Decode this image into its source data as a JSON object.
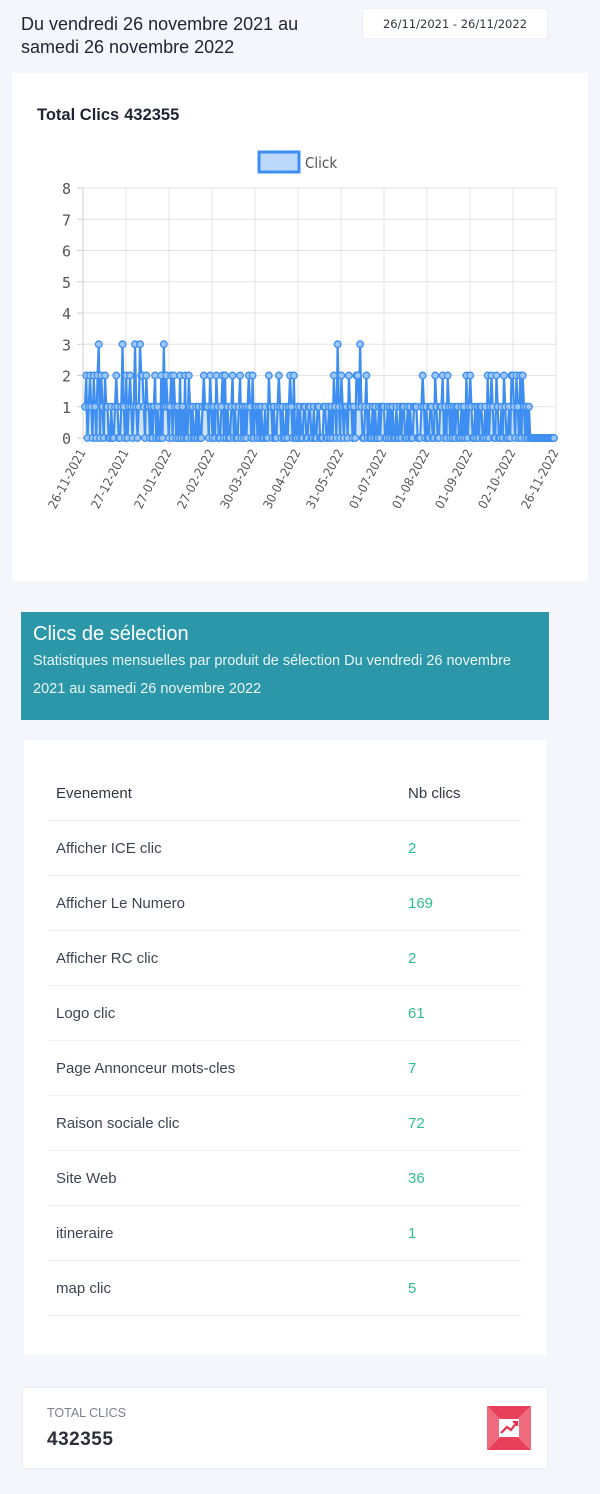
{
  "header": {
    "title": "Du vendredi 26 novembre 2021 au samedi 26 novembre 2022",
    "date_range": "26/11/2021 - 26/11/2022"
  },
  "chart_card": {
    "title_label": "Total Clics",
    "title_value": "432355"
  },
  "chart_data": {
    "type": "line",
    "legend": [
      "Click"
    ],
    "legend_position": "top",
    "series_color": "#3d8ef0",
    "ylim": [
      0,
      8
    ],
    "y_ticks": [
      "0",
      "1",
      "2",
      "3",
      "4",
      "5",
      "6",
      "7",
      "8"
    ],
    "x_ticks": [
      "26-11-2021",
      "27-12-2021",
      "27-01-2022",
      "27-02-2022",
      "30-03-2022",
      "30-04-2022",
      "31-05-2022",
      "01-07-2022",
      "01-08-2022",
      "01-09-2022",
      "02-10-2022",
      "26-11-2022"
    ],
    "series": [
      {
        "name": "Click",
        "values": [
          1,
          2,
          0,
          1,
          2,
          1,
          0,
          2,
          1,
          0,
          2,
          3,
          0,
          2,
          1,
          0,
          2,
          1,
          1,
          0,
          0,
          1,
          0,
          0,
          1,
          2,
          1,
          0,
          0,
          1,
          3,
          1,
          0,
          2,
          0,
          1,
          2,
          1,
          0,
          1,
          3,
          1,
          0,
          1,
          3,
          2,
          2,
          1,
          0,
          2,
          1,
          1,
          0,
          1,
          0,
          1,
          2,
          0,
          1,
          0,
          0,
          2,
          0,
          3,
          1,
          2,
          1,
          0,
          1,
          2,
          0,
          2,
          1,
          0,
          1,
          0,
          2,
          0,
          1,
          0,
          2,
          0,
          0,
          2,
          1,
          0,
          1,
          0,
          0,
          1,
          0,
          1,
          0,
          0,
          1,
          2,
          1,
          1,
          1,
          0,
          2,
          1,
          0,
          1,
          0,
          2,
          1,
          0,
          0,
          1,
          2,
          0,
          2,
          0,
          1,
          0,
          0,
          1,
          2,
          0,
          1,
          0,
          0,
          1,
          2,
          0,
          1,
          0,
          1,
          0,
          1,
          2,
          1,
          0,
          2,
          0,
          1,
          1,
          0,
          1,
          0,
          1,
          0,
          0,
          1,
          0,
          0,
          2,
          1,
          1,
          0,
          1,
          0,
          0,
          1,
          2,
          1,
          0,
          1,
          0,
          0,
          1,
          0,
          1,
          2,
          1,
          0,
          2,
          0,
          0,
          1,
          0,
          1,
          0,
          0,
          1,
          1,
          0,
          0,
          1,
          1,
          0,
          0,
          1,
          0,
          0,
          1,
          1,
          0,
          0,
          0,
          1,
          1,
          0,
          0,
          1,
          0,
          1,
          0,
          2,
          1,
          0,
          3,
          1,
          0,
          2,
          1,
          0,
          1,
          1,
          0,
          2,
          1,
          1,
          0,
          1,
          0,
          2,
          2,
          1,
          3,
          1,
          0,
          0,
          1,
          2,
          0,
          1,
          0,
          0,
          1,
          0,
          1,
          0,
          0,
          1,
          0,
          1,
          1,
          1,
          0,
          0,
          1,
          0,
          1,
          0,
          1,
          0,
          0,
          1,
          0,
          0,
          1,
          0,
          1,
          1,
          0,
          0,
          1,
          0,
          1,
          0,
          0,
          1,
          1,
          1,
          0,
          0,
          0,
          1,
          2,
          1,
          0,
          1,
          0,
          0,
          1,
          1,
          0,
          0,
          2,
          1,
          0,
          0,
          1,
          1,
          2,
          0,
          1,
          0,
          2,
          1,
          0,
          1,
          0,
          1,
          0,
          1,
          1,
          0,
          0,
          1,
          0,
          1,
          0,
          2,
          0,
          1,
          2,
          1,
          0,
          0,
          1,
          0,
          1,
          0,
          1,
          1,
          0,
          0,
          1,
          0,
          2,
          0,
          1,
          2,
          1,
          0,
          0,
          2,
          1,
          0,
          0,
          1,
          0,
          2,
          1,
          0,
          0,
          1,
          0,
          2,
          2,
          1,
          0,
          2,
          1,
          0,
          2,
          0,
          2,
          1,
          0,
          1,
          0,
          1,
          0,
          0,
          0,
          0,
          0,
          0,
          0,
          0,
          0,
          0,
          0,
          0,
          0,
          0,
          0,
          0,
          0,
          0,
          0,
          0
        ]
      }
    ]
  },
  "banner": {
    "title": "Clics de sélection",
    "subtitle": "Statistiques mensuelles par produit de sélection Du vendredi 26 novembre 2021 au samedi 26 novembre 2022"
  },
  "table": {
    "headers": [
      "Evenement",
      "Nb clics"
    ],
    "rows": [
      {
        "event": "Afficher ICE clic",
        "clicks": "2"
      },
      {
        "event": "Afficher Le Numero",
        "clicks": "169"
      },
      {
        "event": "Afficher RC clic",
        "clicks": "2"
      },
      {
        "event": "Logo clic",
        "clicks": "61"
      },
      {
        "event": "Page Annonceur mots-cles",
        "clicks": "7"
      },
      {
        "event": "Raison sociale clic",
        "clicks": "72"
      },
      {
        "event": "Site Web",
        "clicks": "36"
      },
      {
        "event": "itineraire",
        "clicks": "1"
      },
      {
        "event": "map clic",
        "clicks": "5"
      }
    ]
  },
  "total_card": {
    "label": "TOTAL CLICS",
    "value": "432355",
    "icon": "chart-up-icon",
    "icon_color": "#e0344f"
  }
}
